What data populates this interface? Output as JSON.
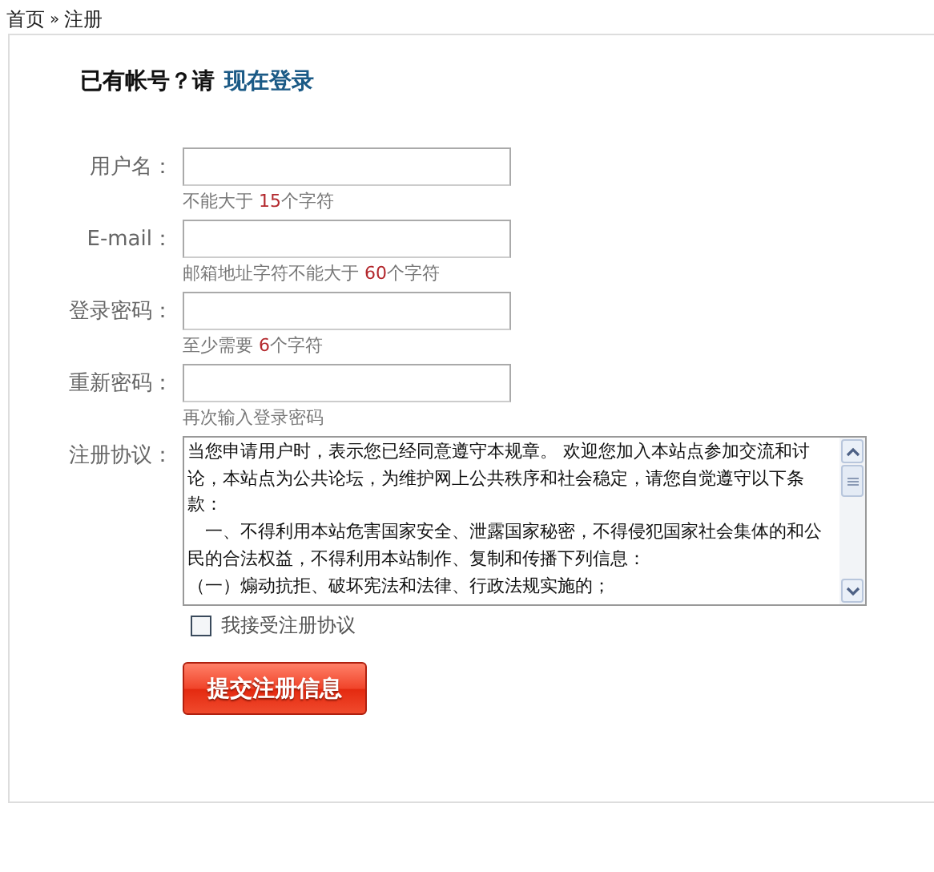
{
  "breadcrumb": {
    "items": [
      "首页",
      "注册"
    ],
    "separator": "»"
  },
  "login_prompt": {
    "text": "已有帐号？请",
    "link": "现在登录"
  },
  "fields": [
    {
      "label": "用户名：",
      "hint": [
        {
          "kind": "plain",
          "text": "不能大于 "
        },
        {
          "kind": "number",
          "text": "15"
        },
        {
          "kind": "plain",
          "text": "个字符"
        }
      ]
    },
    {
      "label": "E-mail：",
      "hint": [
        {
          "kind": "plain",
          "text": "邮箱地址字符不能大于 "
        },
        {
          "kind": "number",
          "text": "60"
        },
        {
          "kind": "plain",
          "text": "个字符"
        }
      ]
    },
    {
      "label": "登录密码：",
      "hint": [
        {
          "kind": "plain",
          "text": "至少需要 "
        },
        {
          "kind": "number",
          "text": "6"
        },
        {
          "kind": "plain",
          "text": "个字符"
        }
      ]
    },
    {
      "label": "重新密码：",
      "hint": [
        {
          "kind": "plain",
          "text": "再次输入登录密码"
        }
      ]
    }
  ],
  "agreement": {
    "label": "注册协议：",
    "lines": [
      "当您申请用户时，表示您已经同意遵守本规章。 欢迎您加入本站点参加交流和讨论，本站点为公共论坛，为维护网上公共秩序和社会稳定，请您自觉遵守以下条款：",
      "　一、不得利用本站危害国家安全、泄露国家秘密，不得侵犯国家社会集体的和公民的合法权益，不得利用本站制作、复制和传播下列信息：",
      "（一）煽动抗拒、破坏宪法和法律、行政法规实施的；"
    ]
  },
  "accept": {
    "label": "我接受注册协议",
    "checked": false
  },
  "submit": {
    "label": "提交注册信息"
  }
}
